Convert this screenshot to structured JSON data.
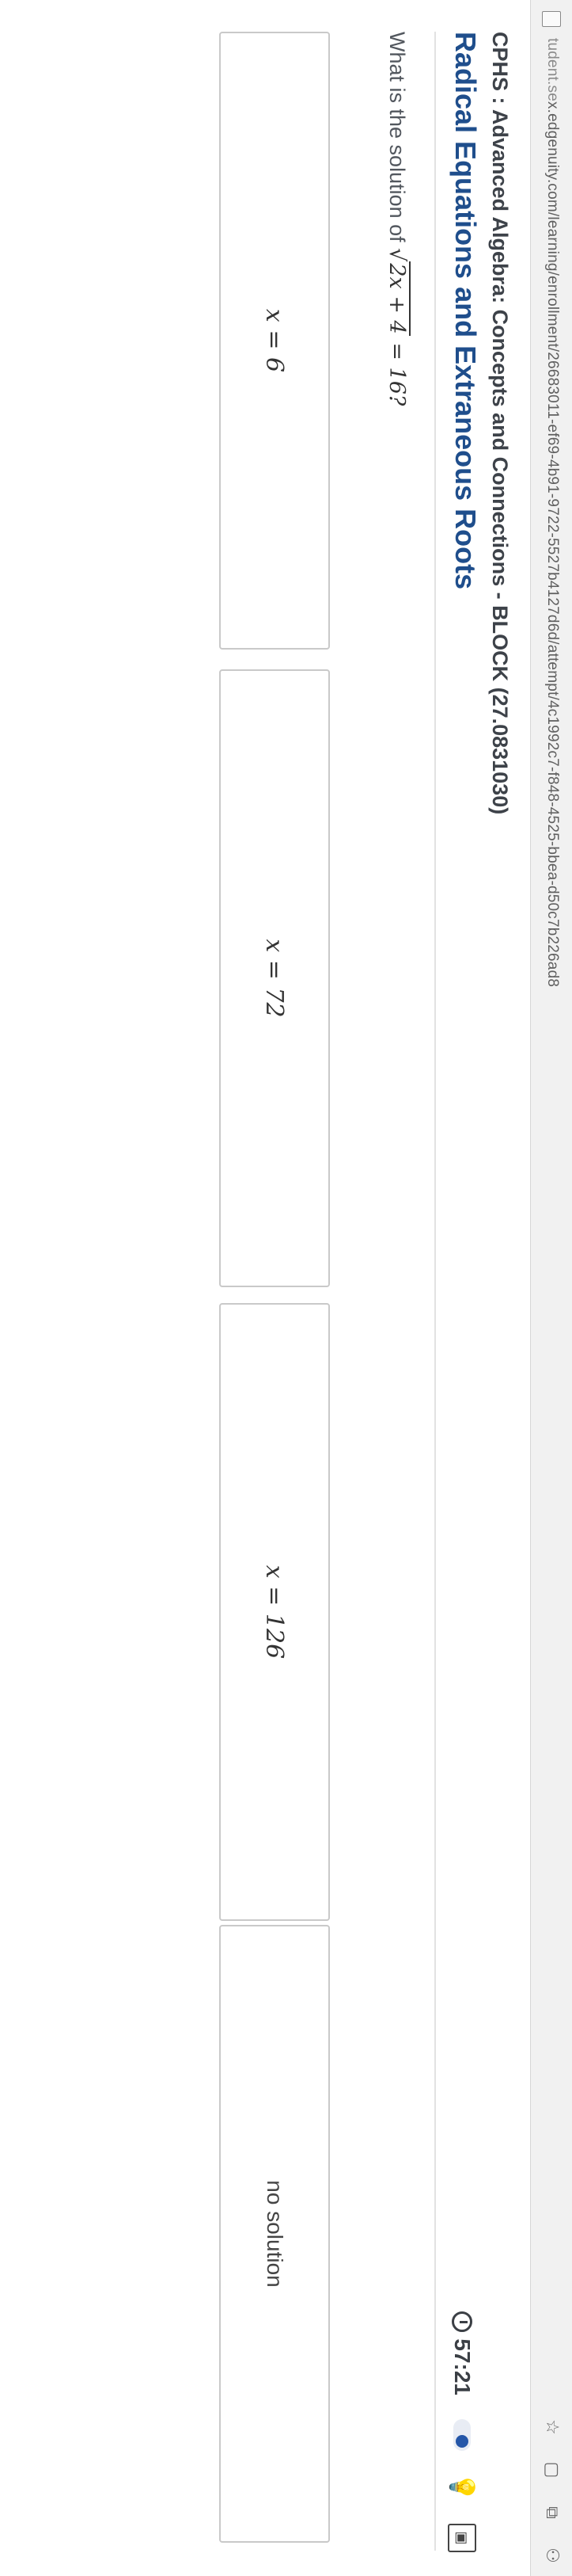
{
  "browser": {
    "url_lead": "tudent.se",
    "url_rest": "x.edgenuity.com/learning/enrollment/26683011-ef69-4b91-9722-5527b4127d6d/attempt/4c1992c7-f848-4525-bbea-d50c7b226ad8"
  },
  "header": {
    "course": "CPHS : Advanced Algebra: Concepts and Connections - BLOCK (27.0831030)",
    "lesson_title": "Radical Equations and Extraneous Roots",
    "timer": "57:21"
  },
  "question": {
    "prompt_prefix": "What is the solution of ",
    "radicand": "2x + 4",
    "rhs": " = 16?"
  },
  "choices": [
    {
      "label": "x = 6"
    },
    {
      "label": "x = 72"
    },
    {
      "label": "x = 126"
    },
    {
      "label": "no solution"
    }
  ],
  "icons": {
    "star": "star-icon",
    "reading_list": "reading-list-icon",
    "extension": "extension-icon",
    "profile": "profile-icon",
    "timer": "timer-icon",
    "hint": "lightbulb-icon",
    "tools": "toolbox-icon"
  },
  "colors": {
    "title": "#1f4e8c",
    "toggle_dot": "#2456a8"
  }
}
